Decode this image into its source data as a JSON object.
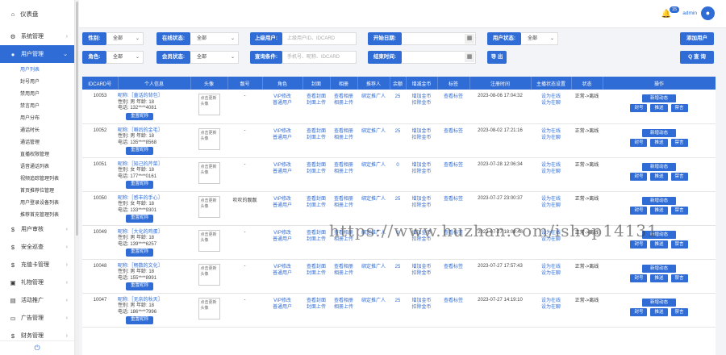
{
  "sidebar": {
    "top": {
      "label": "仪表盘"
    },
    "items_before": [
      {
        "label": "系统管理"
      }
    ],
    "active": {
      "label": "用户管理"
    },
    "subs": [
      "用户列表",
      "封号用户",
      "禁用用户",
      "禁言用户",
      "用户分布",
      "通话时长",
      "通话管理",
      "直播权限管理",
      "语音通话列表",
      "视频追踪管理列表",
      "首页推荐位管理",
      "用户登录设备列表",
      "推荐首充管理列表"
    ],
    "items_after": [
      {
        "label": "用户审核"
      },
      {
        "label": "安全巡查"
      },
      {
        "label": "充值卡管理"
      },
      {
        "label": "礼物管理"
      },
      {
        "label": "活动推广"
      },
      {
        "label": "广告管理"
      },
      {
        "label": "财务管理"
      }
    ]
  },
  "header": {
    "badge": "15",
    "user": "admin"
  },
  "filters": {
    "gender_label": "性别:",
    "gender_value": "全部",
    "online_label": "在线状态:",
    "online_value": "全部",
    "user_label": "上级用户:",
    "user_placeholder": "上级用户ID、IDCARD",
    "start_label": "开始日期:",
    "ustatus_label": "用户状态:",
    "ustatus_value": "全部",
    "add_btn": "添加用户",
    "role_label": "角色:",
    "role_value": "全部",
    "member_label": "会员状态:",
    "member_value": "全部",
    "query_label": "查询条件:",
    "query_placeholder": "手机号、昵称、IDCARD",
    "end_label": "结束时间:",
    "export_btn": "导 出",
    "search_btn": "Q 查 询"
  },
  "table": {
    "headers": [
      "IDCARD号",
      "个人信息",
      "头像",
      "靓号",
      "角色",
      "封面",
      "相册",
      "推荐人",
      "余额",
      "增减金币",
      "标签",
      "注册时间",
      "主播状态设置",
      "状态",
      "操作"
    ],
    "rows": [
      {
        "id": "10053",
        "nick": "昵称:［童话的背包］",
        "sexage": "性别: 男 年龄: 18",
        "phone": "电话: 132****4081",
        "pretty": "-",
        "balance": "25",
        "time": "2023-08-06 17:04:32",
        "status": "正常->离线",
        "ops": 3
      },
      {
        "id": "10052",
        "nick": "昵称:［噼后的金毛］",
        "sexage": "性别: 男 年龄: 18",
        "phone": "电话: 135****8568",
        "pretty": "-",
        "balance": "25",
        "time": "2023-08-02 17:21:16",
        "status": "正常->离线",
        "ops": 3
      },
      {
        "id": "10051",
        "nick": "昵称:［知己的芹菜］",
        "sexage": "性别: 女 年龄: 18",
        "phone": "电话: 177****0161",
        "pretty": "-",
        "balance": "0",
        "time": "2023-07-28 12:06:34",
        "status": "正常->离线",
        "ops": 3
      },
      {
        "id": "10050",
        "nick": "昵称:［感丰的手心］",
        "sexage": "性别: 女 年龄: 18",
        "phone": "电话: 133****9301",
        "pretty": "吹吹的靓靓",
        "balance": "25",
        "time": "2023-07-27 23:00:37",
        "status": "正常->离线",
        "ops": 3
      },
      {
        "id": "10049",
        "nick": "昵称:［大化的鸡蛋］",
        "sexage": "性别: 男 年龄: 18",
        "phone": "电话: 139****6257",
        "pretty": "-",
        "balance": "0",
        "time": "2023-07-27 18:09:48",
        "status": "正常->离线",
        "ops": 3
      },
      {
        "id": "10048",
        "nick": "昵称:［畅数的文化］",
        "sexage": "性别: 男 年龄: 18",
        "phone": "电话: 155****8991",
        "pretty": "-",
        "balance": "25",
        "time": "2023-07-27 17:57:43",
        "status": "正常->离线",
        "ops": 3
      },
      {
        "id": "10047",
        "nick": "昵称:［无奈的秋天］",
        "sexage": "性别: 男 年龄: 18",
        "phone": "电话: 186****7996",
        "pretty": "-",
        "balance": "25",
        "time": "2023-07-27 14:19:10",
        "status": "正常->离线",
        "ops": 3
      }
    ],
    "text": {
      "reset": "重置昵称",
      "avatar": "点击更新头像",
      "role1": "VIP修改",
      "role2": "普通用户",
      "cover1": "查看封面",
      "cover2": "封面上传",
      "album1": "查看相册",
      "album2": "相册上传",
      "ref": "绑定推广人",
      "coin1": "增加金币",
      "coin2": "扣除金币",
      "tag": "查看标签",
      "anchor1": "设为在线",
      "anchor2": "设为在聊",
      "op_dyn": "新增动态",
      "op_ban": "封号",
      "op_push": "推送",
      "op_mute": "禁言"
    }
  },
  "watermark": "https://www.huzhan.com/ishop14131"
}
